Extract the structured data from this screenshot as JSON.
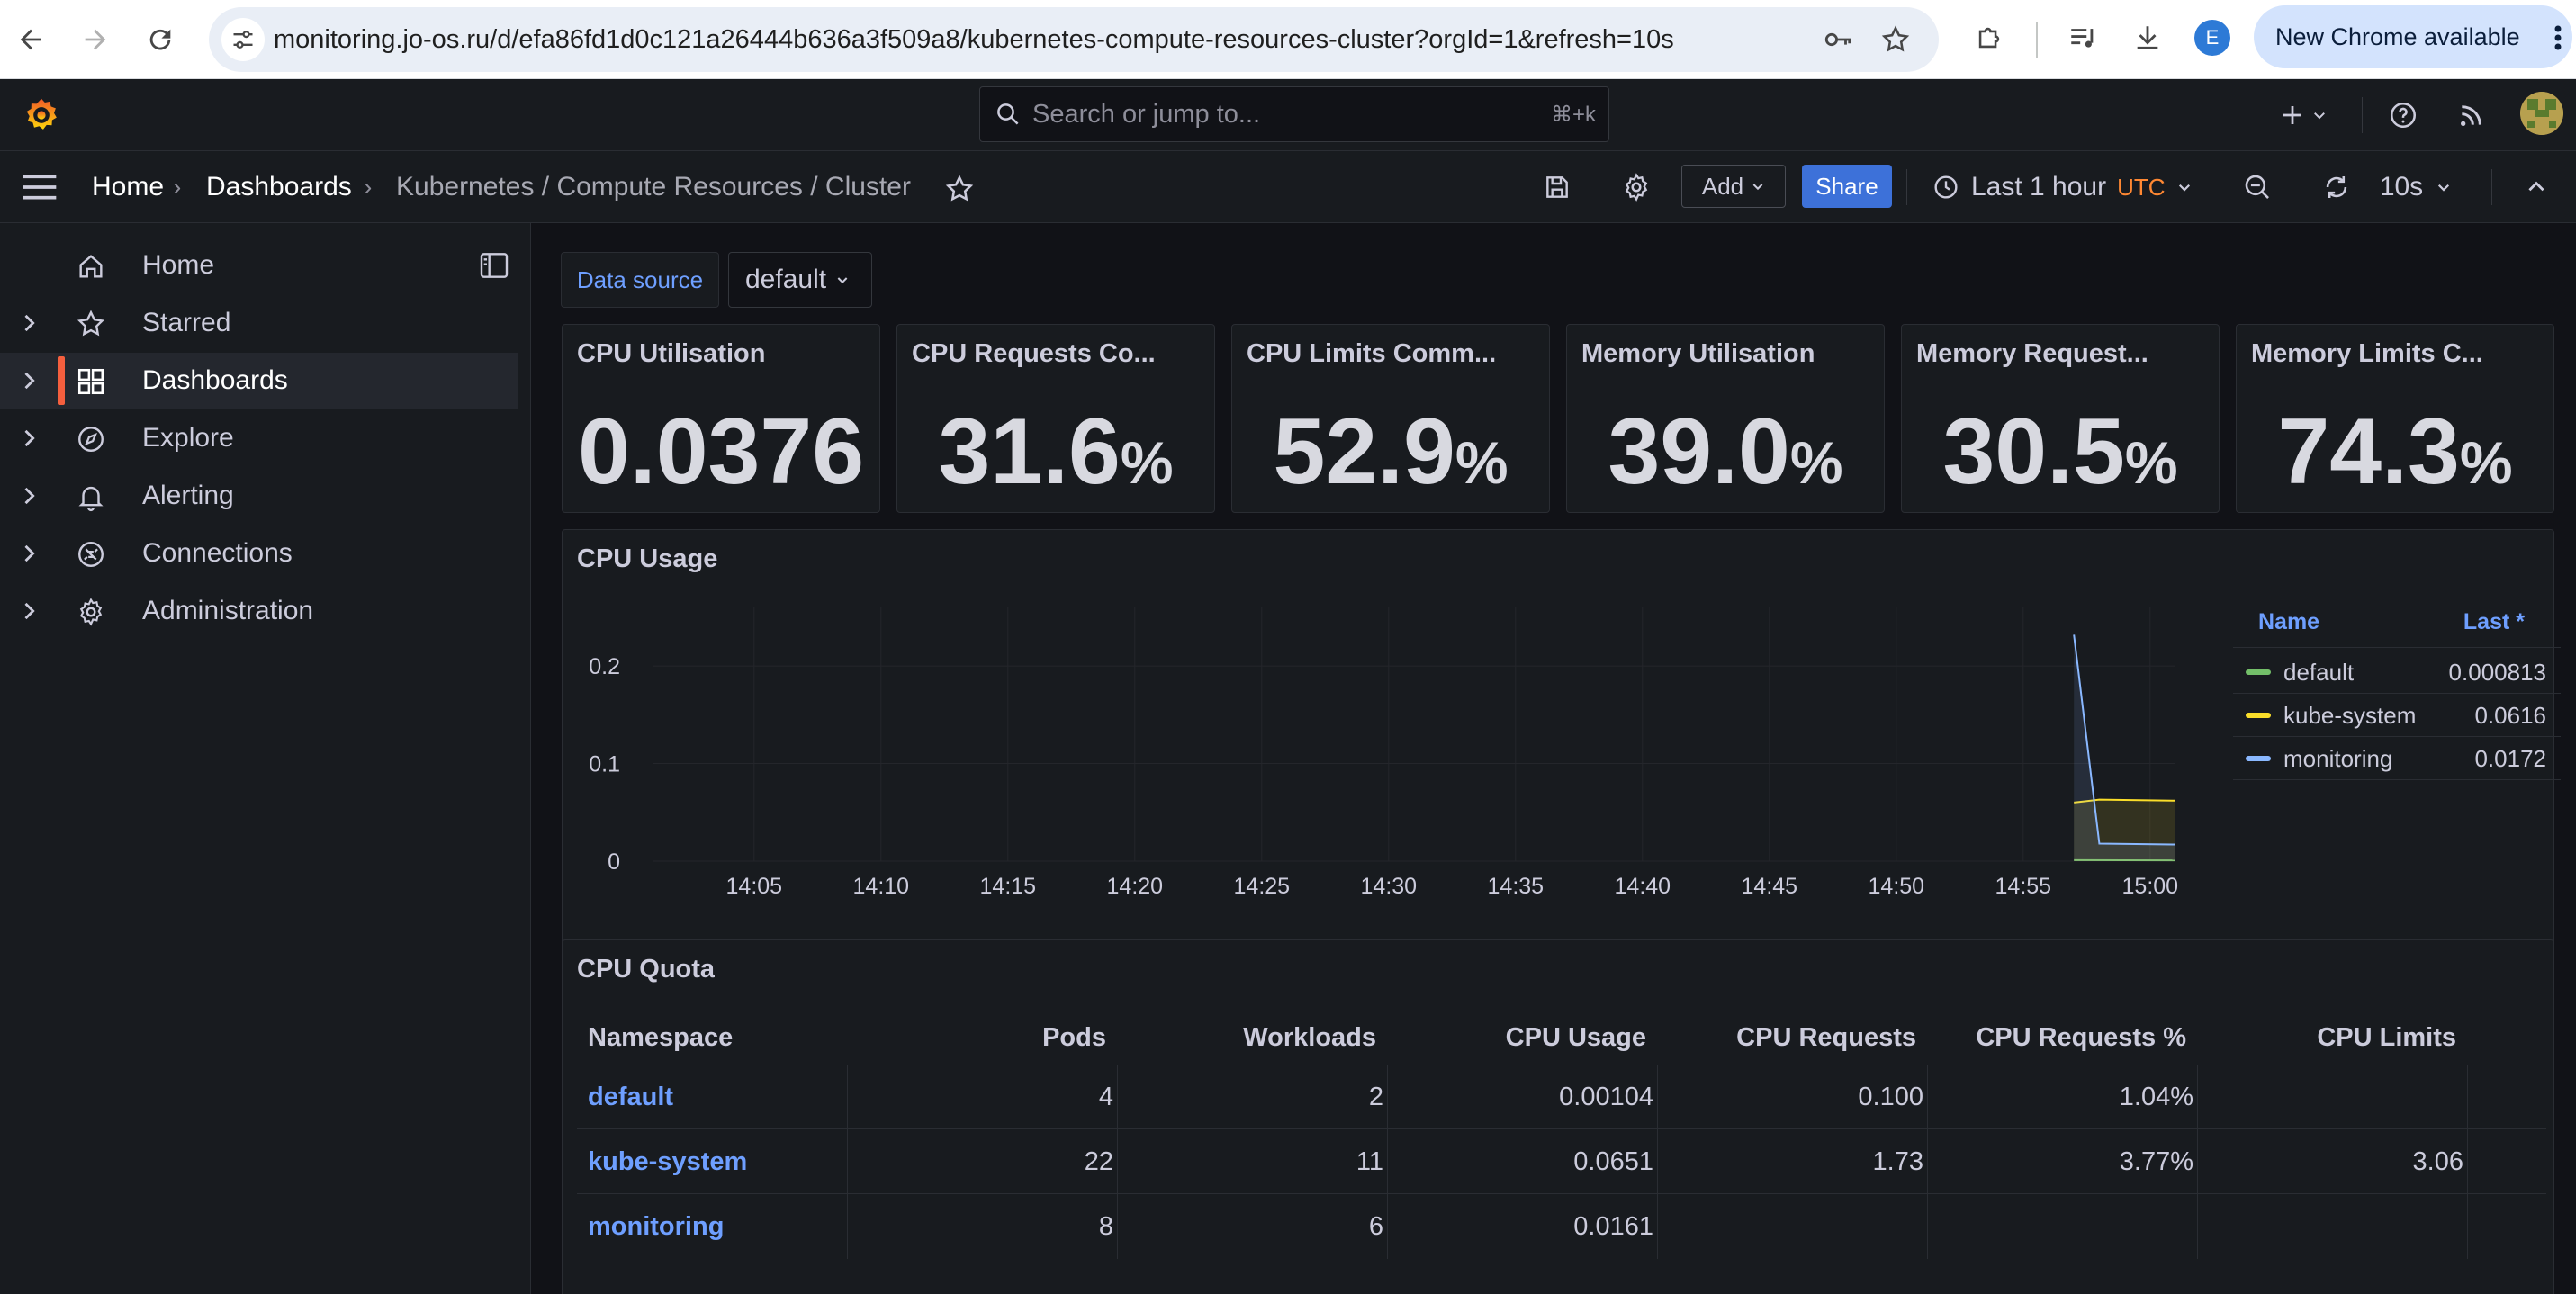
{
  "browser": {
    "url": "monitoring.jo-os.ru/d/efa86fd1d0c121a26444b636a3f509a8/kubernetes-compute-resources-cluster?orgId=1&refresh=10s",
    "profile_initial": "E",
    "update_label": "New Chrome available"
  },
  "topbar": {
    "search_placeholder": "Search or jump to...",
    "search_shortcut": "⌘+k"
  },
  "breadcrumbs": [
    "Home",
    "Dashboards",
    "Kubernetes / Compute Resources / Cluster"
  ],
  "toolbar": {
    "add_label": "Add",
    "share_label": "Share",
    "time_range": "Last 1 hour",
    "timezone": "UTC",
    "refresh_interval": "10s"
  },
  "sidebar": {
    "items": [
      {
        "label": "Home",
        "icon": "home-icon"
      },
      {
        "label": "Starred",
        "icon": "star-icon"
      },
      {
        "label": "Dashboards",
        "icon": "dashboards-icon"
      },
      {
        "label": "Explore",
        "icon": "compass-icon"
      },
      {
        "label": "Alerting",
        "icon": "bell-icon"
      },
      {
        "label": "Connections",
        "icon": "connections-icon"
      },
      {
        "label": "Administration",
        "icon": "gear-icon"
      }
    ]
  },
  "variables": {
    "datasource_label": "Data source",
    "datasource_value": "default"
  },
  "stats": [
    {
      "title": "CPU Utilisation",
      "value": "0.0376",
      "unit": ""
    },
    {
      "title": "CPU Requests Co...",
      "value": "31.6",
      "unit": "%"
    },
    {
      "title": "CPU Limits Comm...",
      "value": "52.9",
      "unit": "%"
    },
    {
      "title": "Memory Utilisation",
      "value": "39.0",
      "unit": "%"
    },
    {
      "title": "Memory Request...",
      "value": "30.5",
      "unit": "%"
    },
    {
      "title": "Memory Limits C...",
      "value": "74.3",
      "unit": "%"
    }
  ],
  "cpu_usage": {
    "title": "CPU Usage",
    "legend_header_name": "Name",
    "legend_header_last": "Last *"
  },
  "chart_data": {
    "type": "line",
    "title": "CPU Usage",
    "xlabel": "",
    "ylabel": "",
    "x_ticks": [
      "14:05",
      "14:10",
      "14:15",
      "14:20",
      "14:25",
      "14:30",
      "14:35",
      "14:40",
      "14:45",
      "14:50",
      "14:55",
      "15:00"
    ],
    "y_ticks": [
      0,
      0.1,
      0.2
    ],
    "ylim": [
      0,
      0.26
    ],
    "x_range": [
      "14:01",
      "15:01"
    ],
    "grid": true,
    "legend_placement": "right",
    "series": [
      {
        "name": "default",
        "color": "#73bf69",
        "last": "0.000813",
        "points": [
          [
            "14:57",
            0.001
          ],
          [
            "15:01",
            0.0008
          ]
        ]
      },
      {
        "name": "kube-system",
        "color": "#fade2a",
        "last": "0.0616",
        "points": [
          [
            "14:57",
            0.06
          ],
          [
            "14:58",
            0.063
          ],
          [
            "15:01",
            0.062
          ]
        ]
      },
      {
        "name": "monitoring",
        "color": "#8ab8ff",
        "last": "0.0172",
        "points": [
          [
            "14:57",
            0.232
          ],
          [
            "14:58",
            0.018
          ],
          [
            "15:01",
            0.017
          ]
        ]
      }
    ]
  },
  "cpu_quota": {
    "title": "CPU Quota",
    "columns": [
      "Namespace",
      "Pods",
      "Workloads",
      "CPU Usage",
      "CPU Requests",
      "CPU Requests %",
      "CPU Limits"
    ],
    "rows": [
      {
        "namespace": "default",
        "pods": "4",
        "workloads": "2",
        "cpu_usage": "0.00104",
        "cpu_requests": "0.100",
        "cpu_requests_pct": "1.04%",
        "cpu_limits": ""
      },
      {
        "namespace": "kube-system",
        "pods": "22",
        "workloads": "11",
        "cpu_usage": "0.0651",
        "cpu_requests": "1.73",
        "cpu_requests_pct": "3.77%",
        "cpu_limits": "3.06"
      },
      {
        "namespace": "monitoring",
        "pods": "8",
        "workloads": "6",
        "cpu_usage": "0.0161",
        "cpu_requests": "",
        "cpu_requests_pct": "",
        "cpu_limits": ""
      }
    ]
  }
}
